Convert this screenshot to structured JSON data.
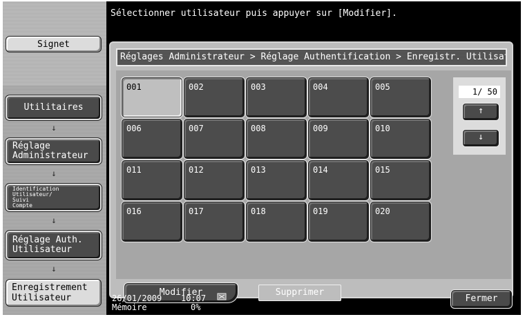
{
  "header": {
    "message": "Sélectionner utilisateur puis appuyer sur [Modifier]."
  },
  "sidebar": {
    "bookmark_label": "Signet",
    "items": [
      {
        "label": "Utilitaires"
      },
      {
        "label_line1": "Réglage",
        "label_line2": "Administrateur"
      },
      {
        "label_line1": "Identification",
        "label_line2": "Utilisateur/",
        "label_line3": "Suivi",
        "label_line4": "Compte"
      },
      {
        "label_line1": "Réglage Auth.",
        "label_line2": "Utilisateur"
      },
      {
        "label_line1": "Enregistrement",
        "label_line2": "Utilisateur"
      }
    ],
    "arrow_glyph": "↓"
  },
  "main": {
    "breadcrumb": "Réglages Administrateur > Réglage Authentification > Enregistr. Utilisateur",
    "tiles": [
      "001",
      "002",
      "003",
      "004",
      "005",
      "006",
      "007",
      "008",
      "009",
      "010",
      "011",
      "012",
      "013",
      "014",
      "015",
      "016",
      "017",
      "018",
      "019",
      "020"
    ],
    "selected_tile": "001",
    "pager": {
      "indicator": "1/ 50",
      "up_icon": "↑",
      "down_icon": "↓"
    },
    "modify_label": "Modifier",
    "delete_label": "Supprimer"
  },
  "status": {
    "date": "26/01/2009",
    "time": "10:07",
    "memory_label": "Mémoire",
    "memory_value": "0%",
    "status_icon": "machine-status-icon"
  },
  "close_label": "Fermer"
}
